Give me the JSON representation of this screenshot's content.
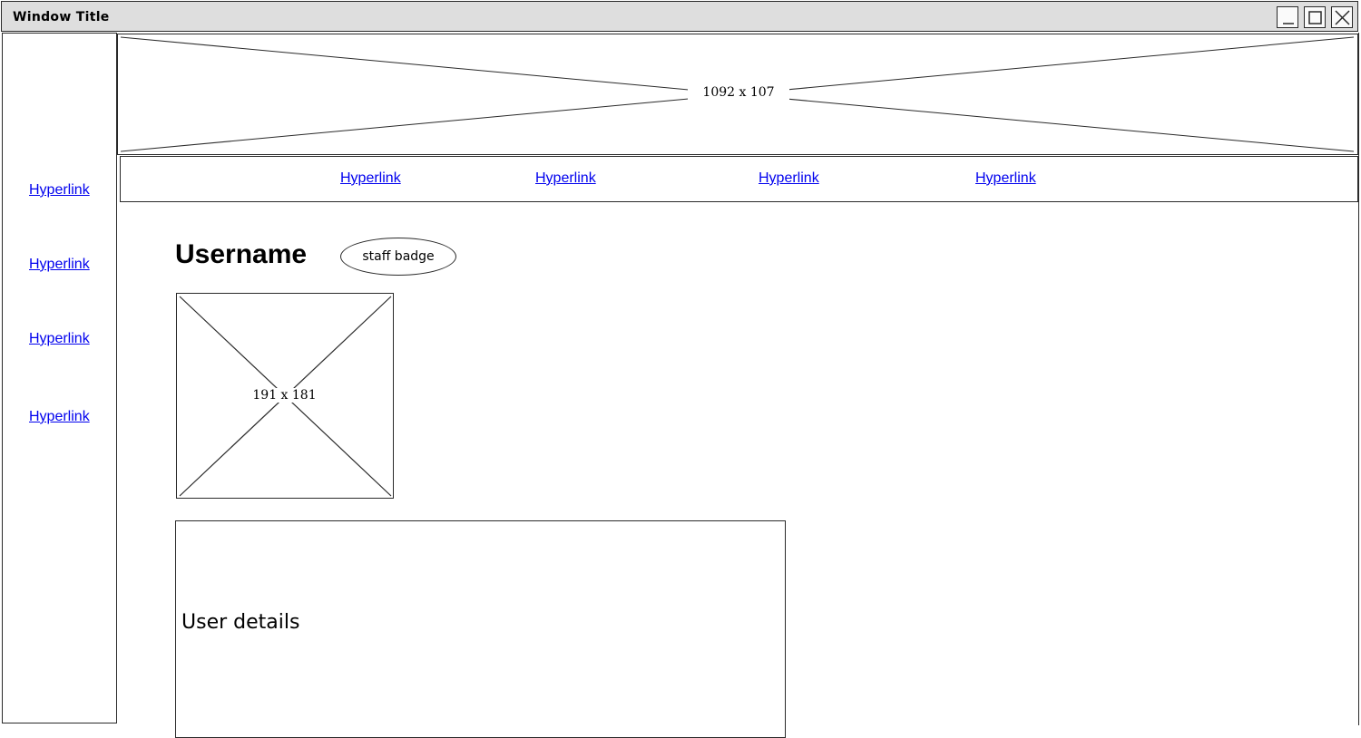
{
  "window": {
    "title": "Window Title"
  },
  "title_bar_buttons": [
    "minimize-icon",
    "maximize-icon",
    "close-icon"
  ],
  "sidebar": {
    "links": [
      "Hyperlink",
      "Hyperlink",
      "Hyperlink",
      "Hyperlink"
    ]
  },
  "banner": {
    "placeholder_label": "1092 x 107"
  },
  "navbar": {
    "links": [
      "Hyperlink",
      "Hyperlink",
      "Hyperlink",
      "Hyperlink"
    ]
  },
  "profile": {
    "username": "Username",
    "badge": "staff badge",
    "avatar_placeholder_label": "191 x 181",
    "details_label": "User details"
  },
  "colors": {
    "link": "#0000ee",
    "titlebar": "#dedede",
    "stroke": "#2a2a2a"
  }
}
